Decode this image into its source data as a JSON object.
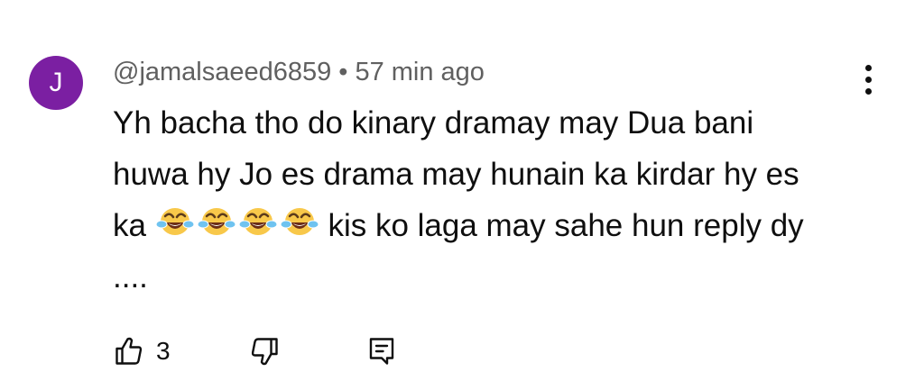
{
  "comment": {
    "avatar_letter": "J",
    "avatar_color": "#7b1fa2",
    "author": "@jamalsaeed6859",
    "separator": "•",
    "timestamp": "57 min ago",
    "text_before_emoji": "Yh bacha tho do kinary dramay may Dua bani huwa hy Jo es drama may hunain ka kirdar hy es ka",
    "emoji": [
      "face-with-tears-of-joy",
      "face-with-tears-of-joy",
      "face-with-tears-of-joy",
      "face-with-tears-of-joy"
    ],
    "text_after_emoji": "kis ko laga may sahe hun reply dy ....",
    "like_count": "3",
    "actions": [
      "like",
      "dislike",
      "reply"
    ],
    "menu_icon": "more-vertical-icon"
  }
}
